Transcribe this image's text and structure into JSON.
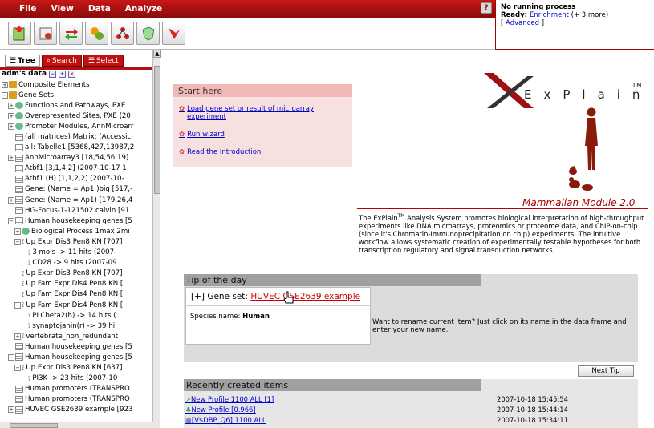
{
  "menu": [
    "File",
    "View",
    "Data",
    "Analyze"
  ],
  "help_label": "?",
  "toolbar_icons": [
    "import-icon",
    "database-icon",
    "arrows-icon",
    "puzzle-icon",
    "network-icon",
    "shield-icon",
    "funnel-icon"
  ],
  "status": {
    "line1": "No running process",
    "ready_prefix": "Ready: ",
    "ready_link": "Enrichment",
    "ready_suffix": " (+ 3 more)",
    "advanced_open": "[ ",
    "advanced": "Advanced",
    "advanced_close": " ]"
  },
  "left": {
    "tabs": [
      "Tree",
      "Search",
      "Select"
    ],
    "root": "adm's data",
    "tree": [
      {
        "exp": "+",
        "icon": "folder",
        "indent": 0,
        "label": "Composite Elements"
      },
      {
        "exp": "-",
        "icon": "folder",
        "indent": 0,
        "label": "Gene Sets"
      },
      {
        "exp": "+",
        "icon": "bio",
        "indent": 1,
        "label": "Functions and Pathways, PXE"
      },
      {
        "exp": "+",
        "icon": "bio",
        "indent": 1,
        "label": "Overepresented Sites, PXE (20"
      },
      {
        "exp": "+",
        "icon": "bio",
        "indent": 1,
        "label": "Promoter Modules, AnnMicroarr"
      },
      {
        "exp": "",
        "icon": "sheet",
        "indent": 1,
        "label": "(all matrices) Matrix: (Accessic"
      },
      {
        "exp": "",
        "icon": "sheet",
        "indent": 1,
        "label": "all: Tabelle1 [5368,427,13987,2"
      },
      {
        "exp": "+",
        "icon": "sheet",
        "indent": 1,
        "label": "AnnMicroarray3 [18,54,56,19]"
      },
      {
        "exp": "",
        "icon": "sheet",
        "indent": 1,
        "label": "Atbf1 [3,1,4,2] (2007-10-17 1"
      },
      {
        "exp": "",
        "icon": "sheet",
        "indent": 1,
        "label": "Atbf1 (H) [1,1,2,2] (2007-10-"
      },
      {
        "exp": "",
        "icon": "sheet",
        "indent": 1,
        "label": "Gene: (Name = Ap1 )big [517,-"
      },
      {
        "exp": "+",
        "icon": "sheet",
        "indent": 1,
        "label": "Gene: (Name = Ap1) [179,26,4"
      },
      {
        "exp": "",
        "icon": "sheet",
        "indent": 1,
        "label": "HG-Focus-1-121502.calvin [91"
      },
      {
        "exp": "-",
        "icon": "sheet",
        "indent": 1,
        "label": "Human housekeeping genes [5"
      },
      {
        "exp": "+",
        "icon": "bio",
        "indent": 2,
        "label": "Biological Process 1max 2mi"
      },
      {
        "exp": "-",
        "icon": "tri",
        "indent": 2,
        "label": "Up Expr Dis3 Pen8 KN [707]"
      },
      {
        "exp": "",
        "icon": "tri",
        "indent": 3,
        "label": "3 mols -> 11 hits (2007-"
      },
      {
        "exp": "",
        "icon": "tri",
        "indent": 3,
        "label": "CD28 -> 9 hits (2007-09"
      },
      {
        "exp": "",
        "icon": "tri",
        "indent": 2,
        "label": "Up Expr Dis3 Pen8 KN [707]"
      },
      {
        "exp": "",
        "icon": "tri",
        "indent": 2,
        "label": "Up Fam Expr Dis4 Pen8 KN ["
      },
      {
        "exp": "",
        "icon": "tri",
        "indent": 2,
        "label": "Up Fam Expr Dis4 Pen8 KN ["
      },
      {
        "exp": "-",
        "icon": "tri",
        "indent": 2,
        "label": "Up Fam Expr Dis4 Pen8 KN ["
      },
      {
        "exp": "",
        "icon": "tri",
        "indent": 3,
        "label": "PLCbeta2(h) -> 14 hits ("
      },
      {
        "exp": "",
        "icon": "tri",
        "indent": 3,
        "label": "synaptojanin(r) -> 39 hi"
      },
      {
        "exp": "+",
        "icon": "tri",
        "indent": 2,
        "label": "vertebrate_non_redundant"
      },
      {
        "exp": "",
        "icon": "sheet",
        "indent": 1,
        "label": "Human housekeeping genes [5"
      },
      {
        "exp": "-",
        "icon": "sheet",
        "indent": 1,
        "label": "Human housekeeping genes [5"
      },
      {
        "exp": "-",
        "icon": "tri",
        "indent": 2,
        "label": "Up Expr Dis3 Pen8 KN [637]"
      },
      {
        "exp": "",
        "icon": "tri",
        "indent": 3,
        "label": "PI3K -> 23 hits (2007-10"
      },
      {
        "exp": "",
        "icon": "sheet",
        "indent": 1,
        "label": "Human promoters (TRANSPRO"
      },
      {
        "exp": "",
        "icon": "sheet",
        "indent": 1,
        "label": "Human promoters (TRANSPRO"
      },
      {
        "exp": "+",
        "icon": "sheet",
        "indent": 1,
        "label": "HUVEC GSE2639 example [923"
      }
    ]
  },
  "main": {
    "logo_text": "ExPlain",
    "logo_tm": "TM",
    "module": "Mammalian Module 2.0",
    "desc_pre": "The ExPlain",
    "desc_tm": "TM",
    "desc_post": " Analysis System promotes biological interpretation of high-throughput experiments like DNA microarrays, proteomics or proteome data, and ChIP-on-chip (since it's Chromatin-Immunoprecipitation on chip) experiments. The intuitive workflow allows systematic creation of experimentally testable hypotheses for both transcription regulatory and signal transduction networks.",
    "start_here": {
      "title": "Start here",
      "items": [
        "Load gene set or result of microarray experiment",
        "Run wizard",
        "Read the Introduction"
      ]
    },
    "tip": {
      "title": "Tip of the day",
      "gene_prefix": "[+] Gene set: ",
      "gene_link": "HUVEC GSE2639 example",
      "species_label": "Species name: ",
      "species_value": "Human",
      "text": "Want to rename current item? Just click on its name in the data frame and enter your new name.",
      "next": "Next Tip"
    },
    "recent": {
      "title": "Recently created items",
      "items": [
        {
          "name": "New Profile 1100 ALL [1]",
          "date": "2007-10-18 15:45:54"
        },
        {
          "name": "New Profile [0.966]",
          "date": "2007-10-18 15:44:14"
        },
        {
          "name": "[V$DBP_Q6] 1100 ALL",
          "date": "2007-10-18 15:34:11"
        }
      ]
    }
  }
}
